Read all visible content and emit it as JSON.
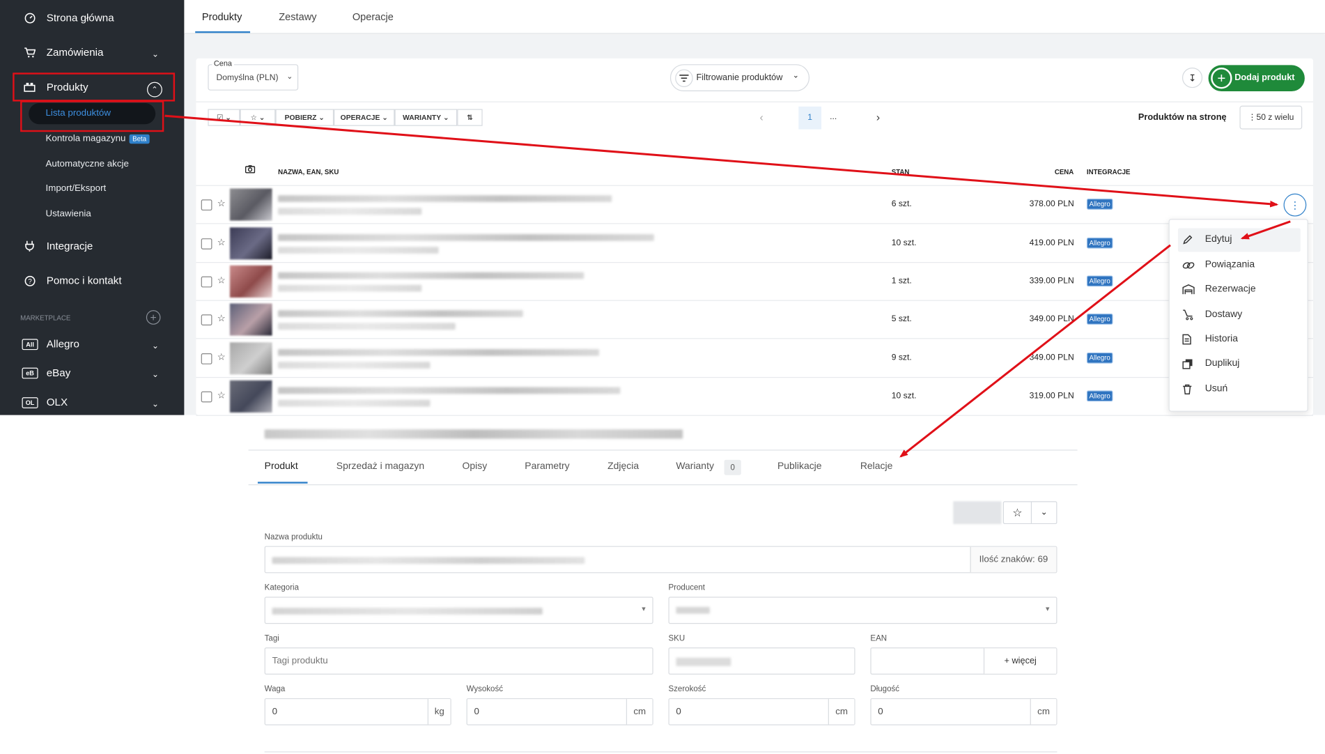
{
  "sidebar": {
    "items": [
      {
        "label": "Strona główna",
        "icon": "dashboard-icon"
      },
      {
        "label": "Zamówienia",
        "icon": "cart-icon"
      },
      {
        "label": "Produkty",
        "icon": "products-icon"
      },
      {
        "label": "Integracje",
        "icon": "plug-icon"
      },
      {
        "label": "Pomoc i kontakt",
        "icon": "help-icon"
      }
    ],
    "sub_items": [
      "Lista produktów",
      "Kontrola magazynu",
      "Automatyczne akcje",
      "Import/Eksport",
      "Ustawienia"
    ],
    "beta_label": "Beta",
    "marketplace_header": "MARKETPLACE",
    "marketplaces": [
      {
        "logo": "All",
        "label": "Allegro"
      },
      {
        "logo": "eB",
        "label": "eBay"
      },
      {
        "logo": "OL",
        "label": "OLX"
      }
    ]
  },
  "top_tabs": [
    "Produkty",
    "Zestawy",
    "Operacje"
  ],
  "filters": {
    "cena_label": "Cena",
    "cena_value": "Domyślna (PLN)",
    "filter_button": "Filtrowanie produktów",
    "add_button": "Dodaj produkt"
  },
  "toolbar": {
    "pobierz": "POBIERZ",
    "operacje": "OPERACJE",
    "warianty": "WARIANTY",
    "page": "1",
    "ellipsis": "...",
    "per_page_label": "Produktów na stronę",
    "per_page_value": "50 z wielu"
  },
  "table": {
    "headers": {
      "name": "NAZWA, EAN, SKU",
      "stan": "STAN",
      "cena": "CENA",
      "integracje": "INTEGRACJE"
    },
    "rows": [
      {
        "stan": "6 szt.",
        "cena": "378.00 PLN",
        "integracja": "Allegro"
      },
      {
        "stan": "10 szt.",
        "cena": "419.00 PLN",
        "integracja": "Allegro"
      },
      {
        "stan": "1 szt.",
        "cena": "339.00 PLN",
        "integracja": "Allegro"
      },
      {
        "stan": "5 szt.",
        "cena": "349.00 PLN",
        "integracja": "Allegro"
      },
      {
        "stan": "9 szt.",
        "cena": "349.00 PLN",
        "integracja": "Allegro"
      },
      {
        "stan": "10 szt.",
        "cena": "319.00 PLN",
        "integracja": "Allegro"
      }
    ]
  },
  "context_menu": [
    {
      "label": "Edytuj",
      "icon": "pencil-icon"
    },
    {
      "label": "Powiązania",
      "icon": "link-icon"
    },
    {
      "label": "Rezerwacje",
      "icon": "garage-icon"
    },
    {
      "label": "Dostawy",
      "icon": "cart-icon"
    },
    {
      "label": "Historia",
      "icon": "document-icon"
    },
    {
      "label": "Duplikuj",
      "icon": "copy-icon"
    },
    {
      "label": "Usuń",
      "icon": "trash-icon"
    }
  ],
  "product_form": {
    "tabs": [
      "Produkt",
      "Sprzedaż i magazyn",
      "Opisy",
      "Parametry",
      "Zdjęcia",
      "Warianty",
      "Publikacje",
      "Relacje"
    ],
    "warianty_count": "0",
    "nazwa_label": "Nazwa produktu",
    "char_count": "Ilość znaków: 69",
    "kategoria_label": "Kategoria",
    "producent_label": "Producent",
    "tagi_label": "Tagi",
    "tagi_placeholder": "Tagi produktu",
    "sku_label": "SKU",
    "ean_label": "EAN",
    "wiecej_button": "+ więcej",
    "waga_label": "Waga",
    "wysokosc_label": "Wysokość",
    "szerokosc_label": "Szerokość",
    "dlugosc_label": "Długość",
    "waga_value": "0",
    "wysokosc_value": "0",
    "szerokosc_value": "0",
    "dlugosc_value": "0",
    "unit_kg": "kg",
    "unit_cm": "cm"
  },
  "colors": {
    "sidebar_bg": "#262b31",
    "accent": "#2f80c9",
    "green": "#1f8a3a",
    "annotation_red": "#e01018"
  }
}
